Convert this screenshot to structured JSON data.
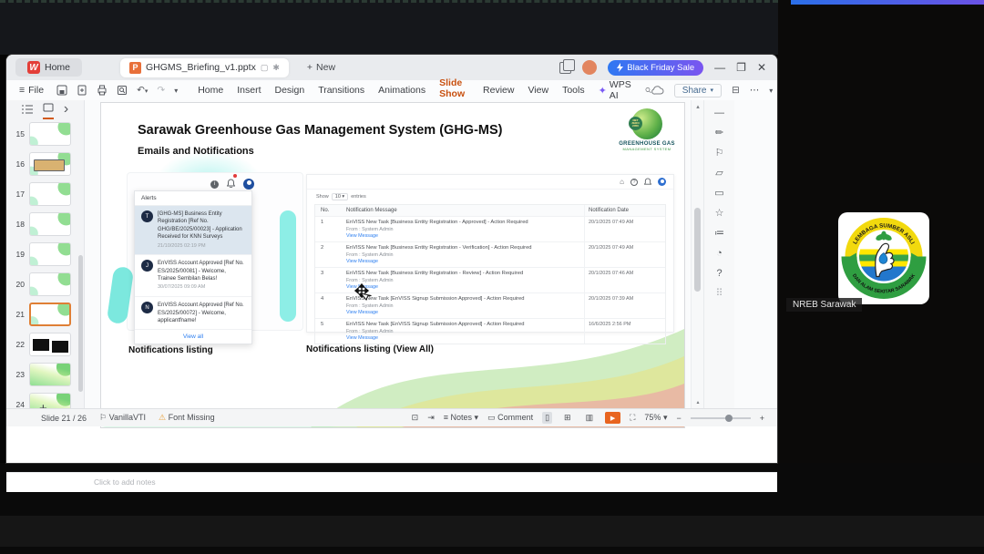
{
  "titlebar": {
    "home_tab": "Home",
    "doc_tab": "GHGMS_Briefing_v1.pptx",
    "new_label": "New",
    "promo": "Black Friday Sale"
  },
  "menubar": {
    "file": "File",
    "items": [
      "Home",
      "Insert",
      "Design",
      "Transitions",
      "Animations",
      "Slide Show",
      "Review",
      "View",
      "Tools"
    ],
    "active_item": "Slide Show",
    "wps_ai": "WPS AI",
    "share": "Share"
  },
  "slide_panel": {
    "items": [
      {
        "num": "15"
      },
      {
        "num": "16"
      },
      {
        "num": "17"
      },
      {
        "num": "18"
      },
      {
        "num": "19"
      },
      {
        "num": "20"
      },
      {
        "num": "21"
      },
      {
        "num": "22"
      },
      {
        "num": "23"
      },
      {
        "num": "24"
      }
    ],
    "selected": "21"
  },
  "slide": {
    "title": "Sarawak Greenhouse Gas Management System (GHG-MS)",
    "subtitle": "Emails and Notifications",
    "logo": {
      "badge": "NET ZERO 2050",
      "line1": "GREENHOUSE GAS",
      "line2": "MANAGEMENT SYSTEM"
    },
    "caption_left": "Notifications listing",
    "caption_right": "Notifications listing (View All)"
  },
  "alerts": {
    "header": "Alerts",
    "view_all": "View all",
    "items": [
      {
        "initial": "T",
        "text": "[GHG-MS] Business Entity Registration [Ref No. GHG/BE/2025/00023] - Application Received for KNN Surveys",
        "time": "21/10/2025 02:19 PM"
      },
      {
        "initial": "J",
        "text": "EnVISS Account Approved [Ref No. ES/2025/00081] - Welcome, Trainee Sembilan Belas!",
        "time": "30/07/2025 09:09 AM"
      },
      {
        "initial": "N",
        "text": "EnVISS Account Approved [Ref No. ES/2025/00072] - Welcome, applicantfname!",
        "time": ""
      }
    ]
  },
  "notif_table": {
    "show": "Show",
    "per_page": "10",
    "entries": "entries",
    "headers": [
      "No.",
      "Notification Message",
      "Notification Date"
    ],
    "from_label": "From : System Admin",
    "link_label": "View Message",
    "rows": [
      {
        "no": "1",
        "message": "EnVISS New Task [Business Entity Registration - Approved] - Action Required",
        "date": "20/1/2025 07:49 AM"
      },
      {
        "no": "2",
        "message": "EnVISS New Task [Business Entity Registration - Verification] - Action Required",
        "date": "20/1/2025 07:49 AM"
      },
      {
        "no": "3",
        "message": "EnVISS New Task [Business Entity Registration - Review] - Action Required",
        "date": "20/1/2025 07:46 AM"
      },
      {
        "no": "4",
        "message": "EnVISS New Task [EnVISS Signup Submission Approved] - Action Required",
        "date": "20/1/2025 07:39 AM"
      },
      {
        "no": "5",
        "message": "EnVISS New Task [EnVISS Signup Submission Approved] - Action Required",
        "date": "16/6/2025 2:56 PM"
      }
    ]
  },
  "notes": {
    "placeholder": "Click to add notes"
  },
  "statusbar": {
    "slide_indicator": "Slide 21 / 26",
    "theme": "VanillaVTI",
    "font_missing": "Font Missing",
    "notes": "Notes",
    "comment": "Comment",
    "zoom": "75%"
  },
  "meeting": {
    "participant_name": "NREB Sarawak",
    "logo_top_text": "LEMBAGA SUMBER ASLI",
    "logo_bottom_text": "DAN ALAM SEKITAR SARAWAK"
  }
}
